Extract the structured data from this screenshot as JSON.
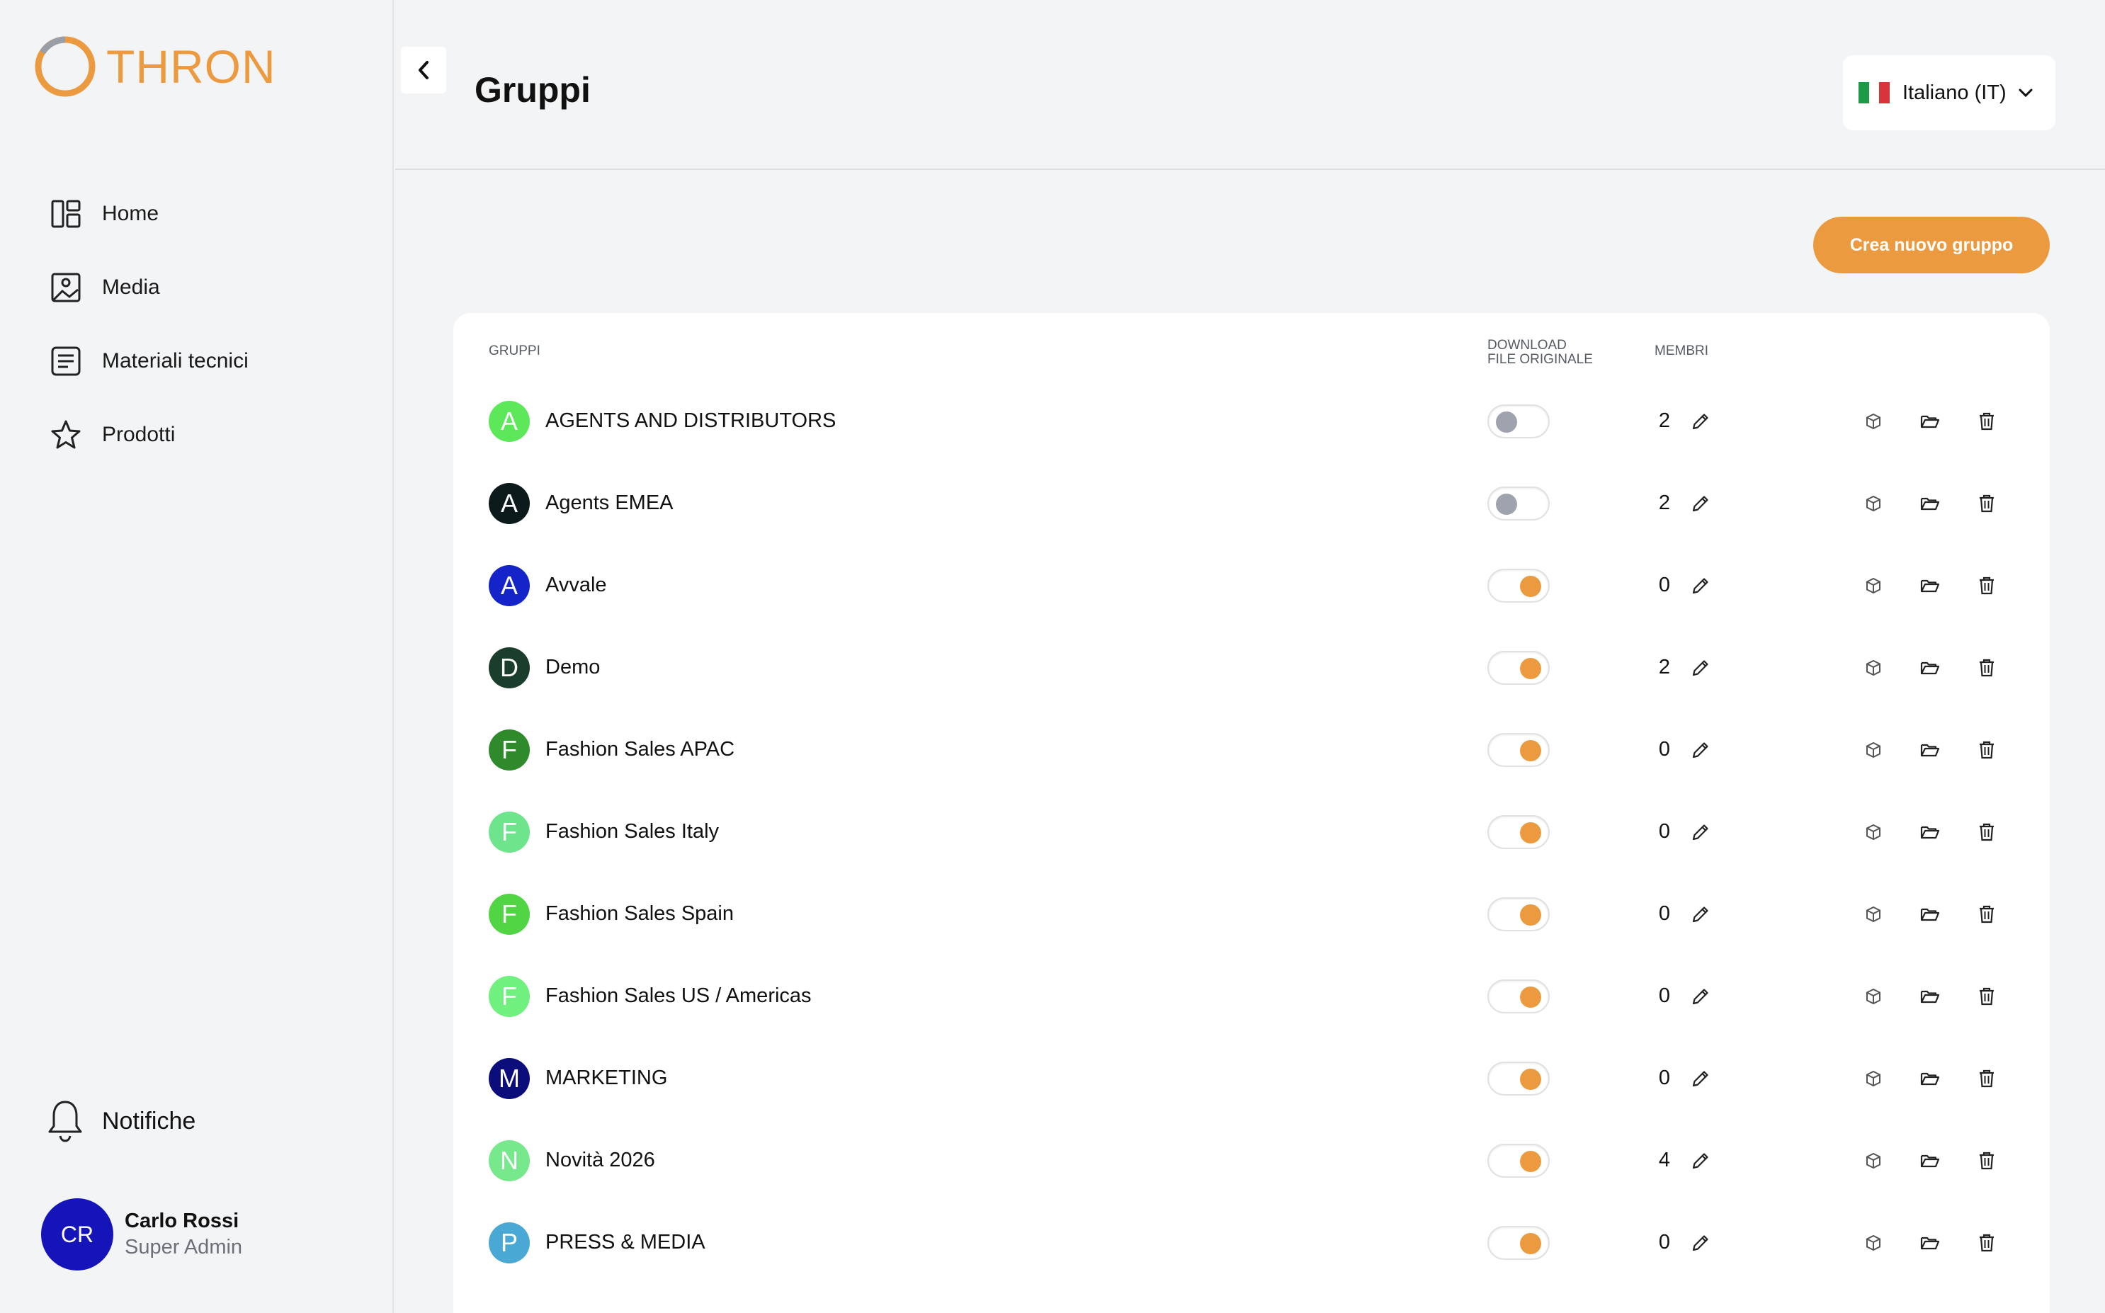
{
  "brand": {
    "name": "THRON",
    "accent": "#ec9a3f"
  },
  "sidebar": {
    "items": [
      {
        "label": "Home",
        "icon": "layout-icon"
      },
      {
        "label": "Media",
        "icon": "image-icon"
      },
      {
        "label": "Materiali tecnici",
        "icon": "document-icon"
      },
      {
        "label": "Prodotti",
        "icon": "star-icon"
      }
    ],
    "notifications_label": "Notifiche",
    "user": {
      "initials": "CR",
      "name": "Carlo Rossi",
      "role": "Super Admin"
    }
  },
  "header": {
    "title": "Gruppi",
    "language": "Italiano (IT)"
  },
  "actions": {
    "create_label": "Crea nuovo gruppo"
  },
  "table": {
    "columns": {
      "group": "GRUPPI",
      "download_line1": "DOWNLOAD",
      "download_line2": "FILE ORIGINALE",
      "members": "MEMBRI"
    },
    "rows": [
      {
        "initial": "A",
        "name": "AGENTS AND DISTRIBUTORS",
        "color": "#5de85a",
        "download": false,
        "members": "2"
      },
      {
        "initial": "A",
        "name": "Agents EMEA",
        "color": "#0d1a1c",
        "download": false,
        "members": "2"
      },
      {
        "initial": "A",
        "name": "Avvale",
        "color": "#1424c9",
        "download": true,
        "members": "0"
      },
      {
        "initial": "D",
        "name": "Demo",
        "color": "#1b3d2c",
        "download": true,
        "members": "2"
      },
      {
        "initial": "F",
        "name": "Fashion Sales APAC",
        "color": "#2e8a2a",
        "download": true,
        "members": "0"
      },
      {
        "initial": "F",
        "name": "Fashion Sales Italy",
        "color": "#6ee58c",
        "download": true,
        "members": "0"
      },
      {
        "initial": "F",
        "name": "Fashion Sales Spain",
        "color": "#52d544",
        "download": true,
        "members": "0"
      },
      {
        "initial": "F",
        "name": "Fashion Sales US / Americas",
        "color": "#70f07e",
        "download": true,
        "members": "0"
      },
      {
        "initial": "M",
        "name": "MARKETING",
        "color": "#0b0e7a",
        "download": true,
        "members": "0"
      },
      {
        "initial": "N",
        "name": "Novità 2026",
        "color": "#78e88c",
        "download": true,
        "members": "4"
      },
      {
        "initial": "P",
        "name": "PRESS & MEDIA",
        "color": "#4aa8d4",
        "download": true,
        "members": "0"
      }
    ]
  }
}
